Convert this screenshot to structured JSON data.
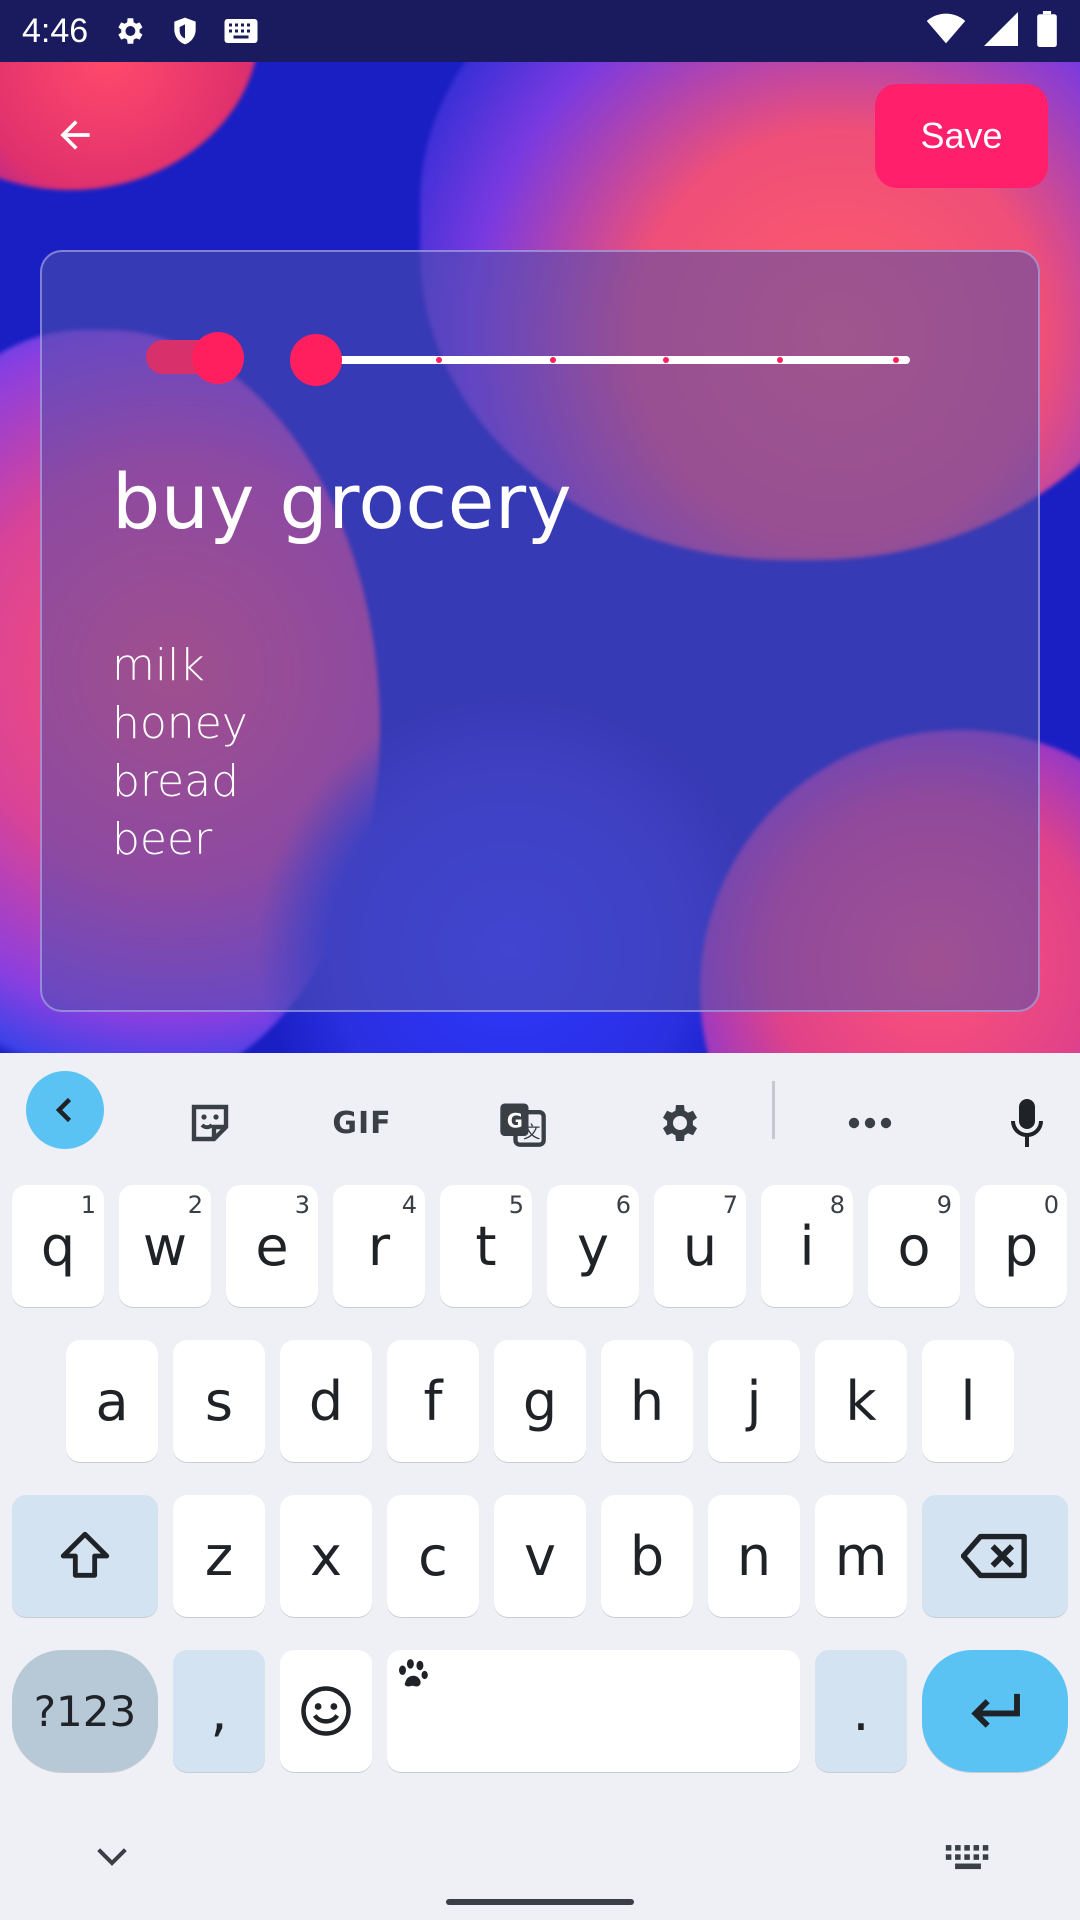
{
  "status_bar": {
    "time": "4:46",
    "left_icons": [
      "gear-icon",
      "shield-icon",
      "keyboard-icon"
    ],
    "right_icons": [
      "wifi-icon",
      "signal-icon",
      "battery-icon"
    ]
  },
  "header": {
    "back_icon": "arrow-left-icon",
    "save_label": "Save"
  },
  "note": {
    "title": "buy grocery",
    "lines": [
      "milk",
      "honey",
      "bread",
      "beer"
    ],
    "toggle_on": true,
    "slider_value_fraction": 0.0,
    "slider_steps": 6
  },
  "keyboard": {
    "toolbar": [
      "chevron-left-icon",
      "sticker-icon",
      "GIF",
      "translate-icon",
      "gear-icon",
      "more-horiz-icon",
      "microphone-icon"
    ],
    "gif_label": "GIF",
    "row1": [
      {
        "key": "q",
        "hint": "1"
      },
      {
        "key": "w",
        "hint": "2"
      },
      {
        "key": "e",
        "hint": "3"
      },
      {
        "key": "r",
        "hint": "4"
      },
      {
        "key": "t",
        "hint": "5"
      },
      {
        "key": "y",
        "hint": "6"
      },
      {
        "key": "u",
        "hint": "7"
      },
      {
        "key": "i",
        "hint": "8"
      },
      {
        "key": "o",
        "hint": "9"
      },
      {
        "key": "p",
        "hint": "0"
      }
    ],
    "row2": [
      "a",
      "s",
      "d",
      "f",
      "g",
      "h",
      "j",
      "k",
      "l"
    ],
    "row3": [
      "z",
      "x",
      "c",
      "v",
      "b",
      "n",
      "m"
    ],
    "symbols_label": "?123",
    "comma": ",",
    "period": "."
  },
  "colors": {
    "accent": "#ff1f6a",
    "keyboard_accent": "#5bc3f3",
    "card_bg": "rgba(80,80,170,0.55)"
  }
}
